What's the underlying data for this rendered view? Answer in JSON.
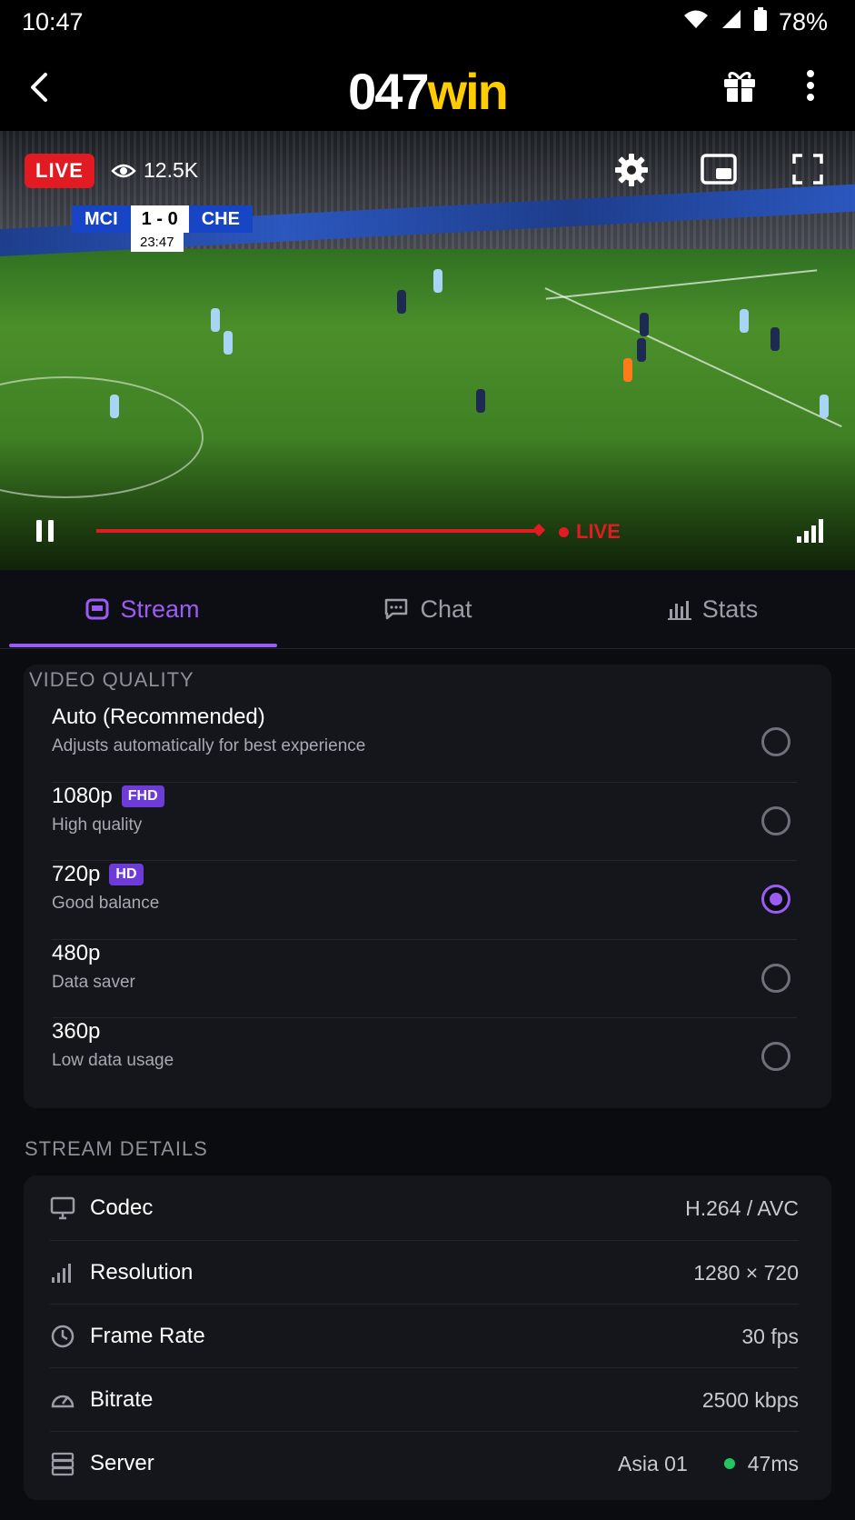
{
  "status_bar": {
    "time": "10:47",
    "battery": "78%"
  },
  "header": {
    "logo_part1": "047",
    "logo_part2": "win"
  },
  "video": {
    "live_badge": "LIVE",
    "viewers": "12.5K",
    "score": {
      "home": "MCI",
      "result": "1 - 0",
      "away": "CHE",
      "clock": "23:47"
    },
    "live_indicator": "LIVE",
    "progress_fraction": 1.0
  },
  "tabs": [
    {
      "label": "Stream",
      "icon": "stream-icon",
      "active": true
    },
    {
      "label": "Chat",
      "icon": "chat-icon",
      "active": false
    },
    {
      "label": "Stats",
      "icon": "stats-icon",
      "active": false
    }
  ],
  "video_quality": {
    "title": "VIDEO QUALITY",
    "options": [
      {
        "label": "Auto (Recommended)",
        "sub": "Adjusts automatically for best experience",
        "badge": "",
        "selected": false
      },
      {
        "label": "1080p",
        "sub": "High quality",
        "badge": "FHD",
        "selected": false
      },
      {
        "label": "720p",
        "sub": "Good balance",
        "badge": "HD",
        "selected": true
      },
      {
        "label": "480p",
        "sub": "Data saver",
        "badge": "",
        "selected": false
      },
      {
        "label": "360p",
        "sub": "Low data usage",
        "badge": "",
        "selected": false
      }
    ]
  },
  "stream_details": {
    "title": "STREAM DETAILS",
    "rows": [
      {
        "icon": "monitor-icon",
        "label": "Codec",
        "value": "H.264 / AVC"
      },
      {
        "icon": "signal-bars-icon",
        "label": "Resolution",
        "value": "1280 × 720"
      },
      {
        "icon": "clock-icon",
        "label": "Frame Rate",
        "value": "30 fps"
      },
      {
        "icon": "gauge-icon",
        "label": "Bitrate",
        "value": "2500 kbps"
      },
      {
        "icon": "server-icon",
        "label": "Server",
        "value": "Asia 01",
        "latency": "47ms"
      }
    ]
  },
  "colors": {
    "accent": "#9b5cf6",
    "live_red": "#e21b23",
    "logo_yellow": "#ffcc00",
    "latency_green": "#22c55e"
  }
}
